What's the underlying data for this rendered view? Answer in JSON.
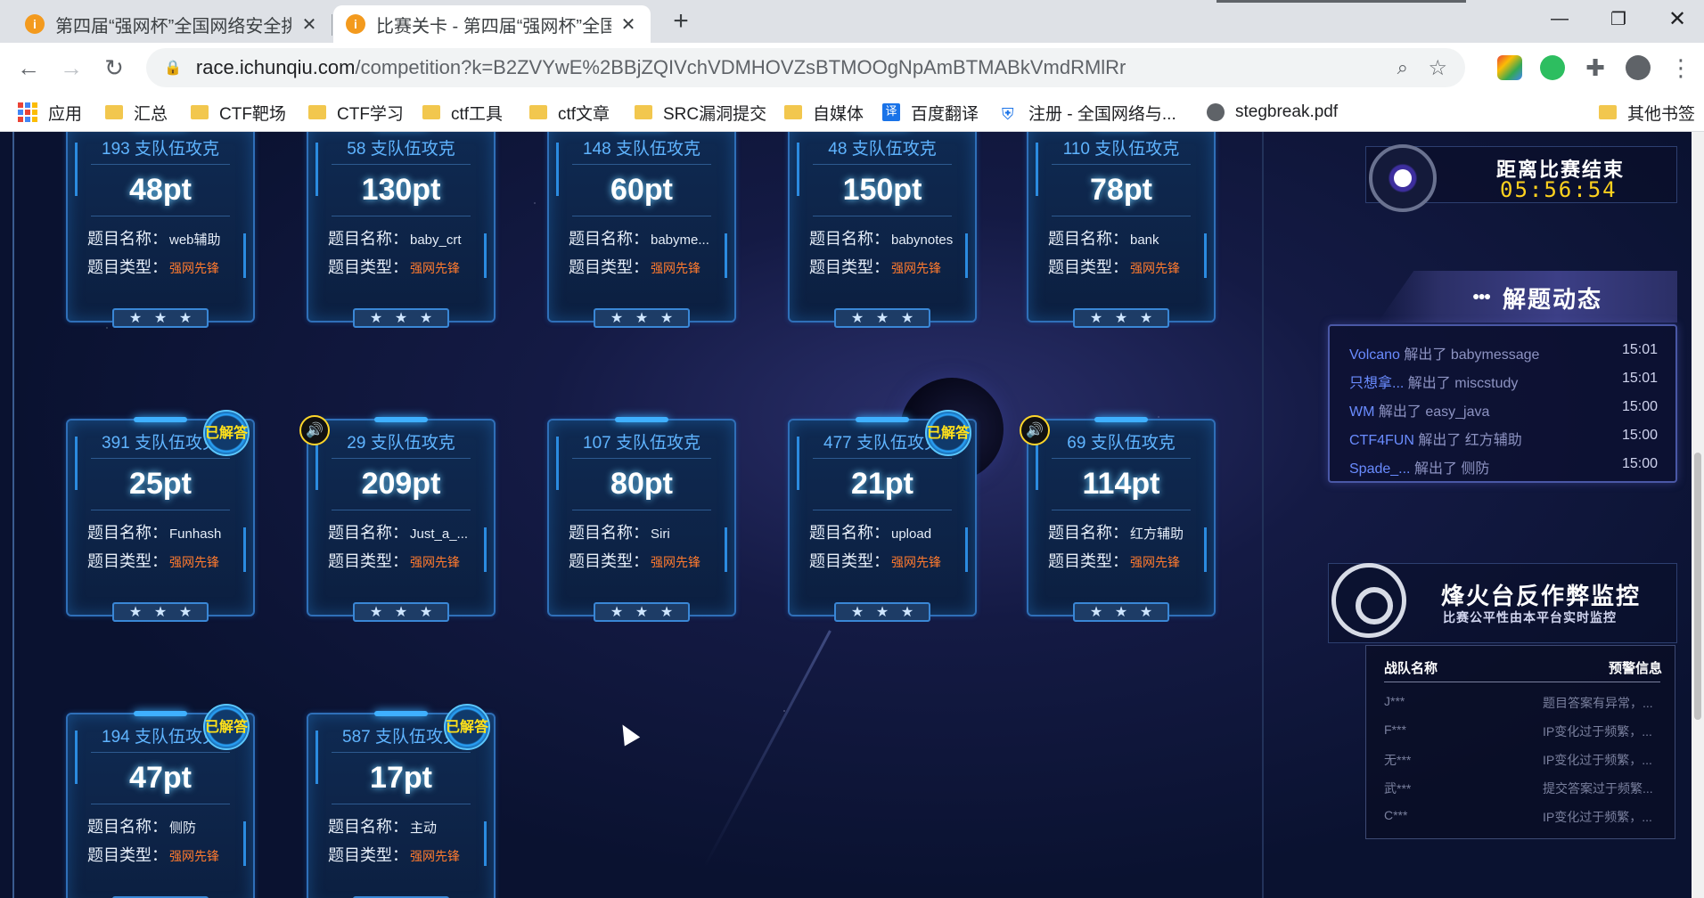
{
  "browser": {
    "tabs": [
      {
        "title": "第四届“强网杯”全国网络安全挑战赛",
        "close": "✕"
      },
      {
        "title": "比赛关卡 - 第四届“强网杯”全国网",
        "close": "✕"
      }
    ],
    "new_tab": "+",
    "window": {
      "min": "—",
      "max": "❐",
      "close": "✕"
    },
    "url_host": "race.ichunqiu.com",
    "url_path": "/competition?k=B2ZVYwE%2BBjZQIVchVDMHOVZsBTMOOgNpAmBTMABkVmdRMlRr",
    "bookmarks": [
      {
        "label": "应用",
        "icon": "apps-icon"
      },
      {
        "label": "汇总",
        "icon": "folder-icon"
      },
      {
        "label": "CTF靶场",
        "icon": "folder-icon"
      },
      {
        "label": "CTF学习",
        "icon": "folder-icon"
      },
      {
        "label": "ctf工具",
        "icon": "folder-icon"
      },
      {
        "label": "ctf文章",
        "icon": "folder-icon"
      },
      {
        "label": "SRC漏洞提交",
        "icon": "folder-icon"
      },
      {
        "label": "自媒体",
        "icon": "folder-icon"
      },
      {
        "label": "百度翻译",
        "icon": "translate-icon"
      },
      {
        "label": "注册 - 全国网络与...",
        "icon": "shield-icon"
      },
      {
        "label": "stegbreak.pdf",
        "icon": "page-icon"
      },
      {
        "label": "其他书签",
        "icon": "folder-icon"
      }
    ]
  },
  "labels": {
    "name": "题目名称：",
    "type": "题目类型：",
    "solved": "已解答",
    "star": "★"
  },
  "cards": [
    {
      "team": "193 支队伍攻克",
      "points": "48pt",
      "name": "web辅助",
      "type": "强网先锋"
    },
    {
      "team": "58 支队伍攻克",
      "points": "130pt",
      "name": "baby_crt",
      "type": "强网先锋"
    },
    {
      "team": "148 支队伍攻克",
      "points": "60pt",
      "name": "babyme...",
      "type": "强网先锋"
    },
    {
      "team": "48 支队伍攻克",
      "points": "150pt",
      "name": "babynotes",
      "type": "强网先锋"
    },
    {
      "team": "110 支队伍攻克",
      "points": "78pt",
      "name": "bank",
      "type": "强网先锋"
    },
    {
      "team": "391 支队伍攻克",
      "points": "25pt",
      "name": "Funhash",
      "type": "强网先锋",
      "badge": "solved"
    },
    {
      "team": "29 支队伍攻克",
      "points": "209pt",
      "name": "Just_a_...",
      "type": "强网先锋",
      "badge": "sound"
    },
    {
      "team": "107 支队伍攻克",
      "points": "80pt",
      "name": "Siri",
      "type": "强网先锋"
    },
    {
      "team": "477 支队伍攻克",
      "points": "21pt",
      "name": "upload",
      "type": "强网先锋",
      "badge": "solved"
    },
    {
      "team": "69 支队伍攻克",
      "points": "114pt",
      "name": "红方辅助",
      "type": "强网先锋",
      "badge": "sound"
    },
    {
      "team": "194 支队伍攻克",
      "points": "47pt",
      "name": "侧防",
      "type": "强网先锋",
      "badge": "solved"
    },
    {
      "team": "587 支队伍攻克",
      "points": "17pt",
      "name": "主动",
      "type": "强网先锋",
      "badge": "solved"
    }
  ],
  "timer": {
    "label": "距离比赛结束",
    "time": "05:56:54"
  },
  "activity": {
    "title": "解题动态",
    "items": [
      {
        "team": "Volcano",
        "text": "解出了 babymessage",
        "time": "15:01"
      },
      {
        "team": "只想拿...",
        "text": "解出了 miscstudy",
        "time": "15:01"
      },
      {
        "team": "WM",
        "text": "解出了 easy_java",
        "time": "15:00"
      },
      {
        "team": "CTF4FUN",
        "text": "解出了 红方辅助",
        "time": "15:00"
      },
      {
        "team": "Spade_...",
        "text": "解出了 侧防",
        "time": "15:00"
      }
    ]
  },
  "monitor": {
    "title": "烽火台反作弊监控",
    "subtitle": "比赛公平性由本平台实时监控",
    "col_team": "战队名称",
    "col_alert": "预警信息",
    "rows": [
      {
        "team": "J***",
        "alert": "题目答案有异常，..."
      },
      {
        "team": "F***",
        "alert": "IP变化过于频繁，..."
      },
      {
        "team": "无***",
        "alert": "IP变化过于频繁，..."
      },
      {
        "team": "武***",
        "alert": "提交答案过于频繁..."
      },
      {
        "team": "C***",
        "alert": "IP变化过于频繁，..."
      }
    ]
  }
}
